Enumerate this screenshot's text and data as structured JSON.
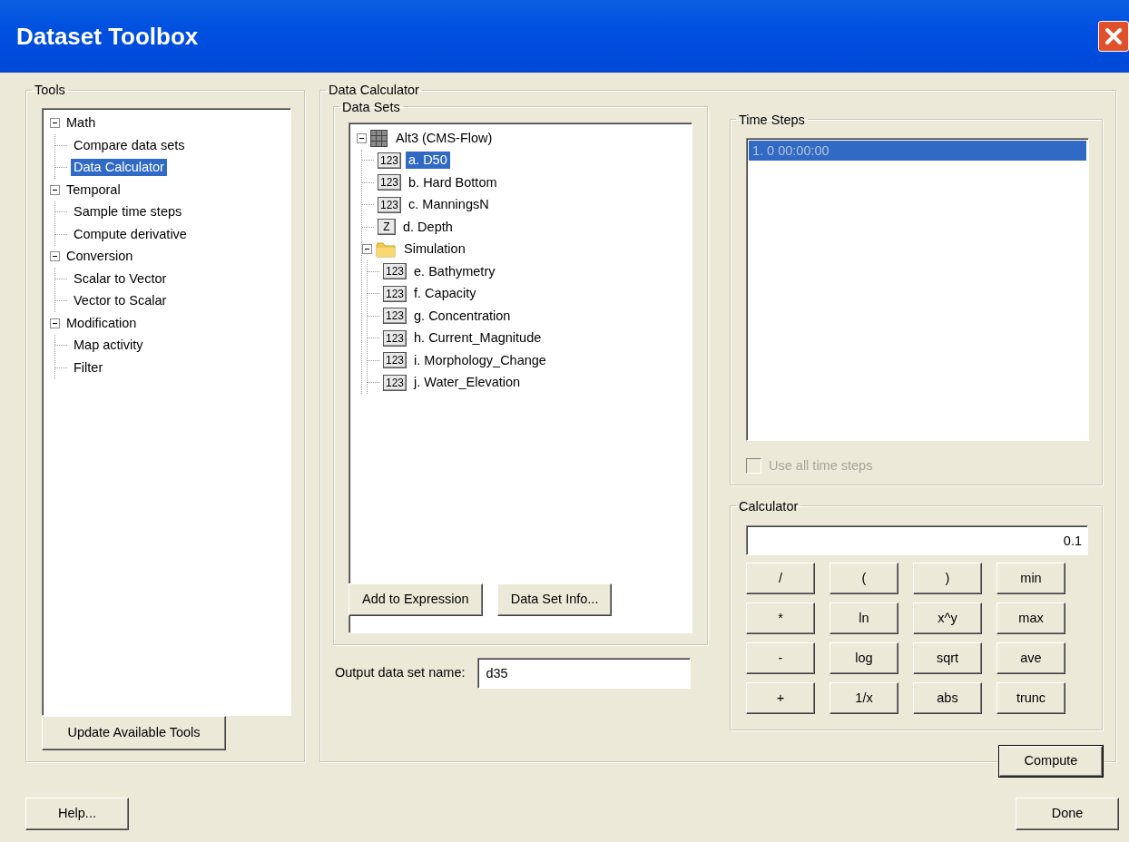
{
  "window": {
    "title": "Dataset Toolbox"
  },
  "tools": {
    "legend": "Tools",
    "tree": [
      {
        "label": "Math",
        "expanded": true,
        "selected": false,
        "children": [
          {
            "label": "Compare data sets",
            "selected": false
          },
          {
            "label": "Data Calculator",
            "selected": true
          }
        ]
      },
      {
        "label": "Temporal",
        "expanded": true,
        "selected": false,
        "children": [
          {
            "label": "Sample time steps",
            "selected": false
          },
          {
            "label": "Compute derivative",
            "selected": false
          }
        ]
      },
      {
        "label": "Conversion",
        "expanded": true,
        "selected": false,
        "children": [
          {
            "label": "Scalar to Vector",
            "selected": false
          },
          {
            "label": "Vector to Scalar",
            "selected": false
          }
        ]
      },
      {
        "label": "Modification",
        "expanded": true,
        "selected": false,
        "children": [
          {
            "label": "Map activity",
            "selected": false
          },
          {
            "label": "Filter",
            "selected": false
          }
        ]
      }
    ],
    "update_button": "Update Available Tools"
  },
  "data_calculator": {
    "legend": "Data Calculator",
    "data_sets": {
      "legend": "Data Sets",
      "tree": [
        {
          "label": "Alt3 (CMS-Flow)",
          "kind": "mesh",
          "expanded": true,
          "selected": false,
          "children": [
            {
              "label": "a. D50",
              "kind": "scalar",
              "icon_text": "123",
              "selected": true
            },
            {
              "label": "b. Hard Bottom",
              "kind": "scalar",
              "icon_text": "123",
              "selected": false
            },
            {
              "label": "c. ManningsN",
              "kind": "scalar",
              "icon_text": "123",
              "selected": false
            },
            {
              "label": "d. Depth",
              "kind": "scalar",
              "icon_text": "Z",
              "selected": false
            },
            {
              "label": "Simulation",
              "kind": "folder",
              "expanded": true,
              "selected": false,
              "children": [
                {
                  "label": "e. Bathymetry",
                  "kind": "scalar",
                  "icon_text": "123",
                  "selected": false
                },
                {
                  "label": "f. Capacity",
                  "kind": "scalar",
                  "icon_text": "123",
                  "selected": false
                },
                {
                  "label": "g. Concentration",
                  "kind": "scalar",
                  "icon_text": "123",
                  "selected": false
                },
                {
                  "label": "h. Current_Magnitude",
                  "kind": "scalar",
                  "icon_text": "123",
                  "selected": false
                },
                {
                  "label": "i. Morphology_Change",
                  "kind": "scalar",
                  "icon_text": "123",
                  "selected": false
                },
                {
                  "label": "j. Water_Elevation",
                  "kind": "scalar",
                  "icon_text": "123",
                  "selected": false
                }
              ]
            }
          ]
        }
      ],
      "buttons": [
        "Add to Expression",
        "Data Set Info..."
      ]
    },
    "output": {
      "label": "Output data set name:",
      "value": "d35"
    },
    "time_steps": {
      "legend": "Time Steps",
      "disabled": true,
      "items": [
        {
          "label": "1. 0 00:00:00",
          "selected": true
        }
      ],
      "use_all": {
        "label": "Use all time steps",
        "checked": false,
        "disabled": true
      }
    },
    "calculator": {
      "legend": "Calculator",
      "expression": "0.1",
      "keys": [
        "/",
        "(",
        ")",
        "min",
        "*",
        "ln",
        "x^y",
        "max",
        "-",
        "log",
        "sqrt",
        "ave",
        "+",
        "1/x",
        "abs",
        "trunc"
      ]
    },
    "compute_button": "Compute"
  },
  "footer": {
    "help_button": "Help...",
    "done_button": "Done"
  }
}
